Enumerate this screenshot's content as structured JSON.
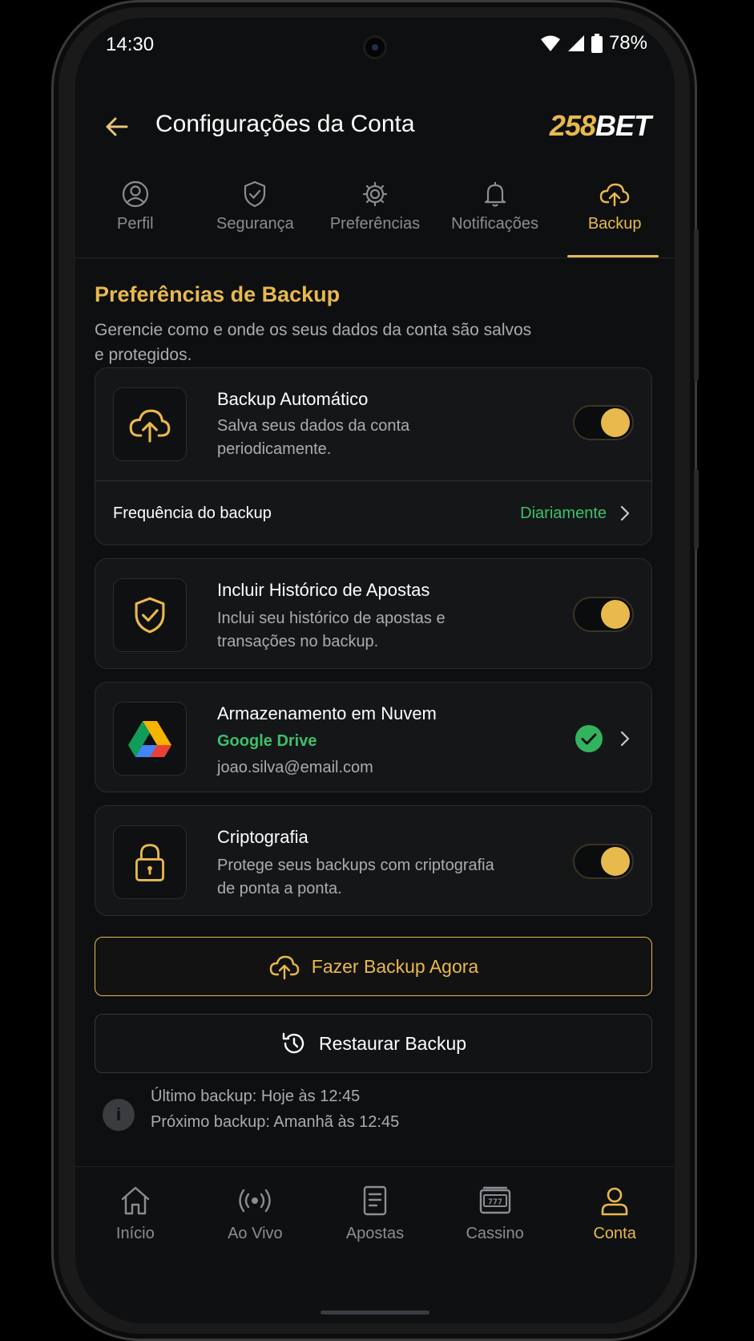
{
  "status_bar": {
    "time": "14:30",
    "battery": "78%"
  },
  "header": {
    "title": "Configurações da Conta",
    "brand_part1": "258",
    "brand_part2": "BET"
  },
  "tabs": [
    {
      "label": "Perfil",
      "icon": "user-icon",
      "active": false
    },
    {
      "label": "Segurança",
      "icon": "shield-icon",
      "active": false
    },
    {
      "label": "Preferências",
      "icon": "gear-icon",
      "active": false
    },
    {
      "label": "Notificações",
      "icon": "bell-icon",
      "active": false
    },
    {
      "label": "Backup",
      "icon": "cloud-upload-icon",
      "active": true
    }
  ],
  "section": {
    "title": "Preferências de Backup",
    "description": "Gerencie como e onde os seus dados da conta são salvos e protegidos."
  },
  "auto_backup": {
    "title": "Backup Automático",
    "description": "Salva seus dados da conta periodicamente.",
    "enabled": true,
    "frequency_label": "Frequência do backup",
    "frequency_value": "Diariamente"
  },
  "bet_history": {
    "title": "Incluir Histórico de Apostas",
    "description": "Inclui seu histórico de apostas e transações no backup.",
    "enabled": true
  },
  "cloud_storage": {
    "title": "Armazenamento em Nuvem",
    "provider": "Google Drive",
    "account": "joao.silva@email.com"
  },
  "encryption": {
    "title": "Criptografia",
    "description": "Protege seus backups com criptografia de ponta a ponta.",
    "enabled": true
  },
  "buttons": {
    "backup_now": "Fazer Backup Agora",
    "restore": "Restaurar Backup"
  },
  "info": {
    "last_backup": "Último backup: Hoje às 12:45",
    "next_backup": "Próximo backup: Amanhã às 12:45"
  },
  "bottom_nav": [
    {
      "label": "Início",
      "icon": "home-icon",
      "active": false
    },
    {
      "label": "Ao Vivo",
      "icon": "live-broadcast-icon",
      "active": false
    },
    {
      "label": "Apostas",
      "icon": "bet-slip-icon",
      "active": false
    },
    {
      "label": "Cassino",
      "icon": "slot-machine-icon",
      "active": false
    },
    {
      "label": "Conta",
      "icon": "user-icon",
      "active": true
    }
  ],
  "colors": {
    "accent": "#e8b94d",
    "success": "#3cc06a",
    "background": "#0e0f10",
    "card": "#141618"
  }
}
